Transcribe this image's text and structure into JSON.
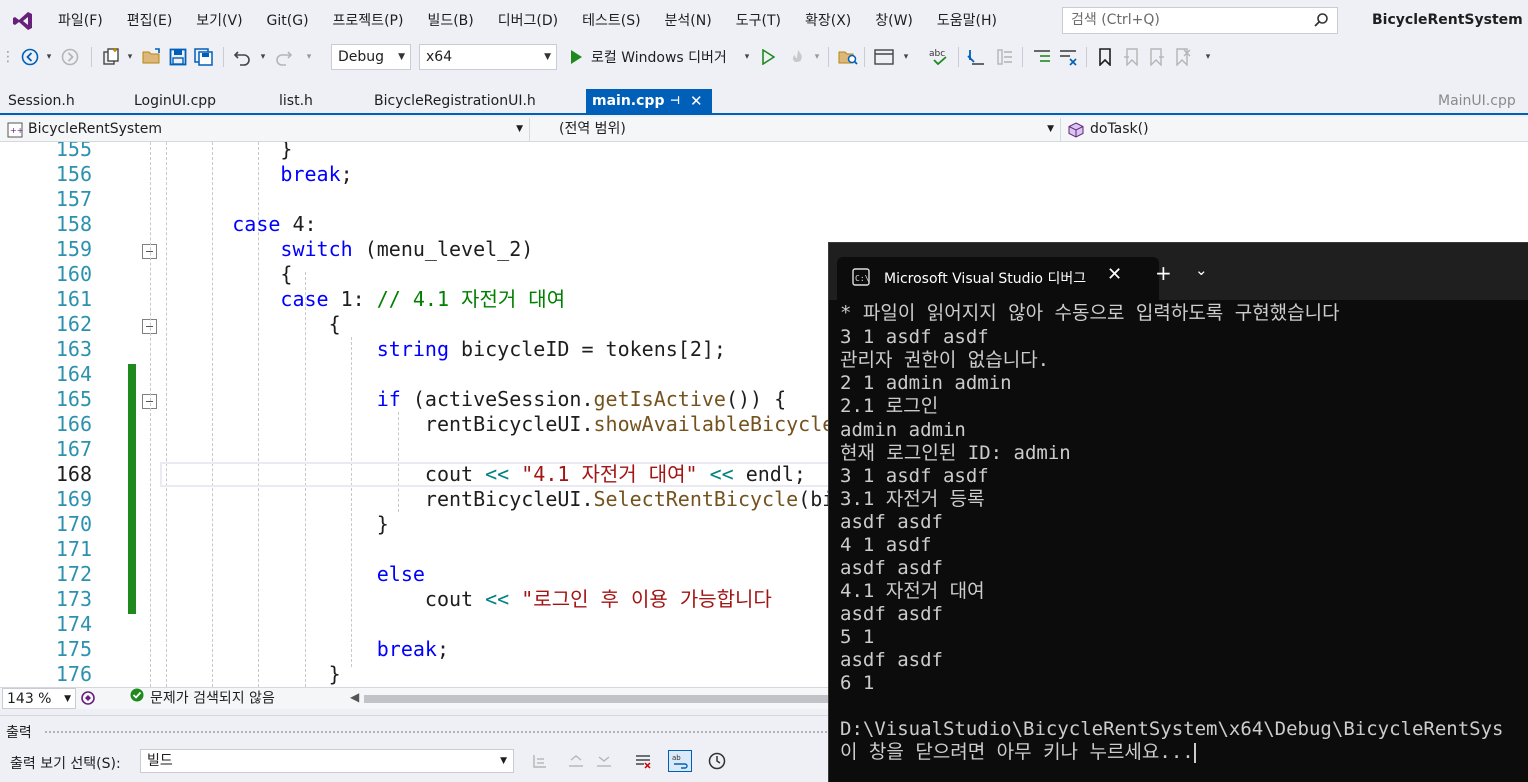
{
  "app": {
    "solution_name": "BicycleRentSystem",
    "menu": [
      "파일(F)",
      "편집(E)",
      "보기(V)",
      "Git(G)",
      "프로젝트(P)",
      "빌드(B)",
      "디버그(D)",
      "테스트(S)",
      "분석(N)",
      "도구(T)",
      "확장(X)",
      "창(W)",
      "도움말(H)"
    ],
    "search_placeholder": "검색 (Ctrl+Q)"
  },
  "toolbar": {
    "config": "Debug",
    "platform": "x64",
    "run_label": "로컬 Windows 디버거"
  },
  "tabs": [
    {
      "label": "Session.h"
    },
    {
      "label": "LoginUI.cpp"
    },
    {
      "label": "list.h"
    },
    {
      "label": "BicycleRegistrationUI.h"
    },
    {
      "label": "main.cpp",
      "active": true
    },
    {
      "label": "MainUI.cpp"
    }
  ],
  "navbar": {
    "project": "BicycleRentSystem",
    "scope": "(전역 범위)",
    "member": "doTask()"
  },
  "editor": {
    "line_numbers": [
      "155",
      "156",
      "157",
      "158",
      "159",
      "160",
      "161",
      "162",
      "163",
      "164",
      "165",
      "166",
      "167",
      "168",
      "169",
      "170",
      "171",
      "172",
      "173",
      "174",
      "175",
      "176"
    ],
    "current_line": "168",
    "code": {
      "l155": "}",
      "l156": "break",
      "l158_kw": "case",
      "l158_rest": " 4:",
      "l159_kw": "switch",
      "l159_rest": " (menu_level_2)",
      "l160": "{",
      "l161_kw": "case",
      "l161_rest": " 1: ",
      "l161_cm": "// 4.1 자전거 대여",
      "l162": "{",
      "l163_kw": "string",
      "l163_rest": " bicycleID = tokens[2];",
      "l165_kw": "if",
      "l165_a": " (activeSession.",
      "l165_fn": "getIsActive",
      "l165_b": "()) {",
      "l166_a": "rentBicycleUI.",
      "l166_fn": "showAvailableBicycle",
      "l168_a": "cout ",
      "l168_op": "<<",
      "l168_str": " \"4.1 자전거 대여\"",
      "l168_op2": " <<",
      "l168_b": " endl;",
      "l169_a": "rentBicycleUI.",
      "l169_fn": "SelectRentBicycle",
      "l169_b": "(bi",
      "l170": "}",
      "l172_kw": "else",
      "l173_a": "cout ",
      "l173_op": "<<",
      "l173_str": " \"로그인 후 이용 가능합니다",
      "l175_kw": "break",
      "l176": "}"
    }
  },
  "status": {
    "zoom": "143 %",
    "issues": "문제가 검색되지 않음"
  },
  "output_panel": {
    "title": "출력",
    "show_label": "출력 보기 선택(S):",
    "source": "빌드"
  },
  "console": {
    "tab_title": "Microsoft Visual Studio 디버그",
    "lines": [
      "* 파일이 읽어지지 않아 수동으로 입력하도록 구현했습니다",
      "3 1 asdf asdf",
      "관리자 권한이 없습니다.",
      "2 1 admin admin",
      "2.1 로그인",
      "admin admin",
      "현재 로그인된 ID: admin",
      "3 1 asdf asdf",
      "3.1 자전거 등록",
      "asdf asdf",
      "4 1 asdf",
      "asdf asdf",
      "4.1 자전거 대여",
      "asdf asdf",
      "5 1",
      "asdf asdf",
      "6 1",
      "",
      "D:\\VisualStudio\\BicycleRentSystem\\x64\\Debug\\BicycleRentSys",
      "이 창을 닫으려면 아무 키나 누르세요..."
    ]
  }
}
